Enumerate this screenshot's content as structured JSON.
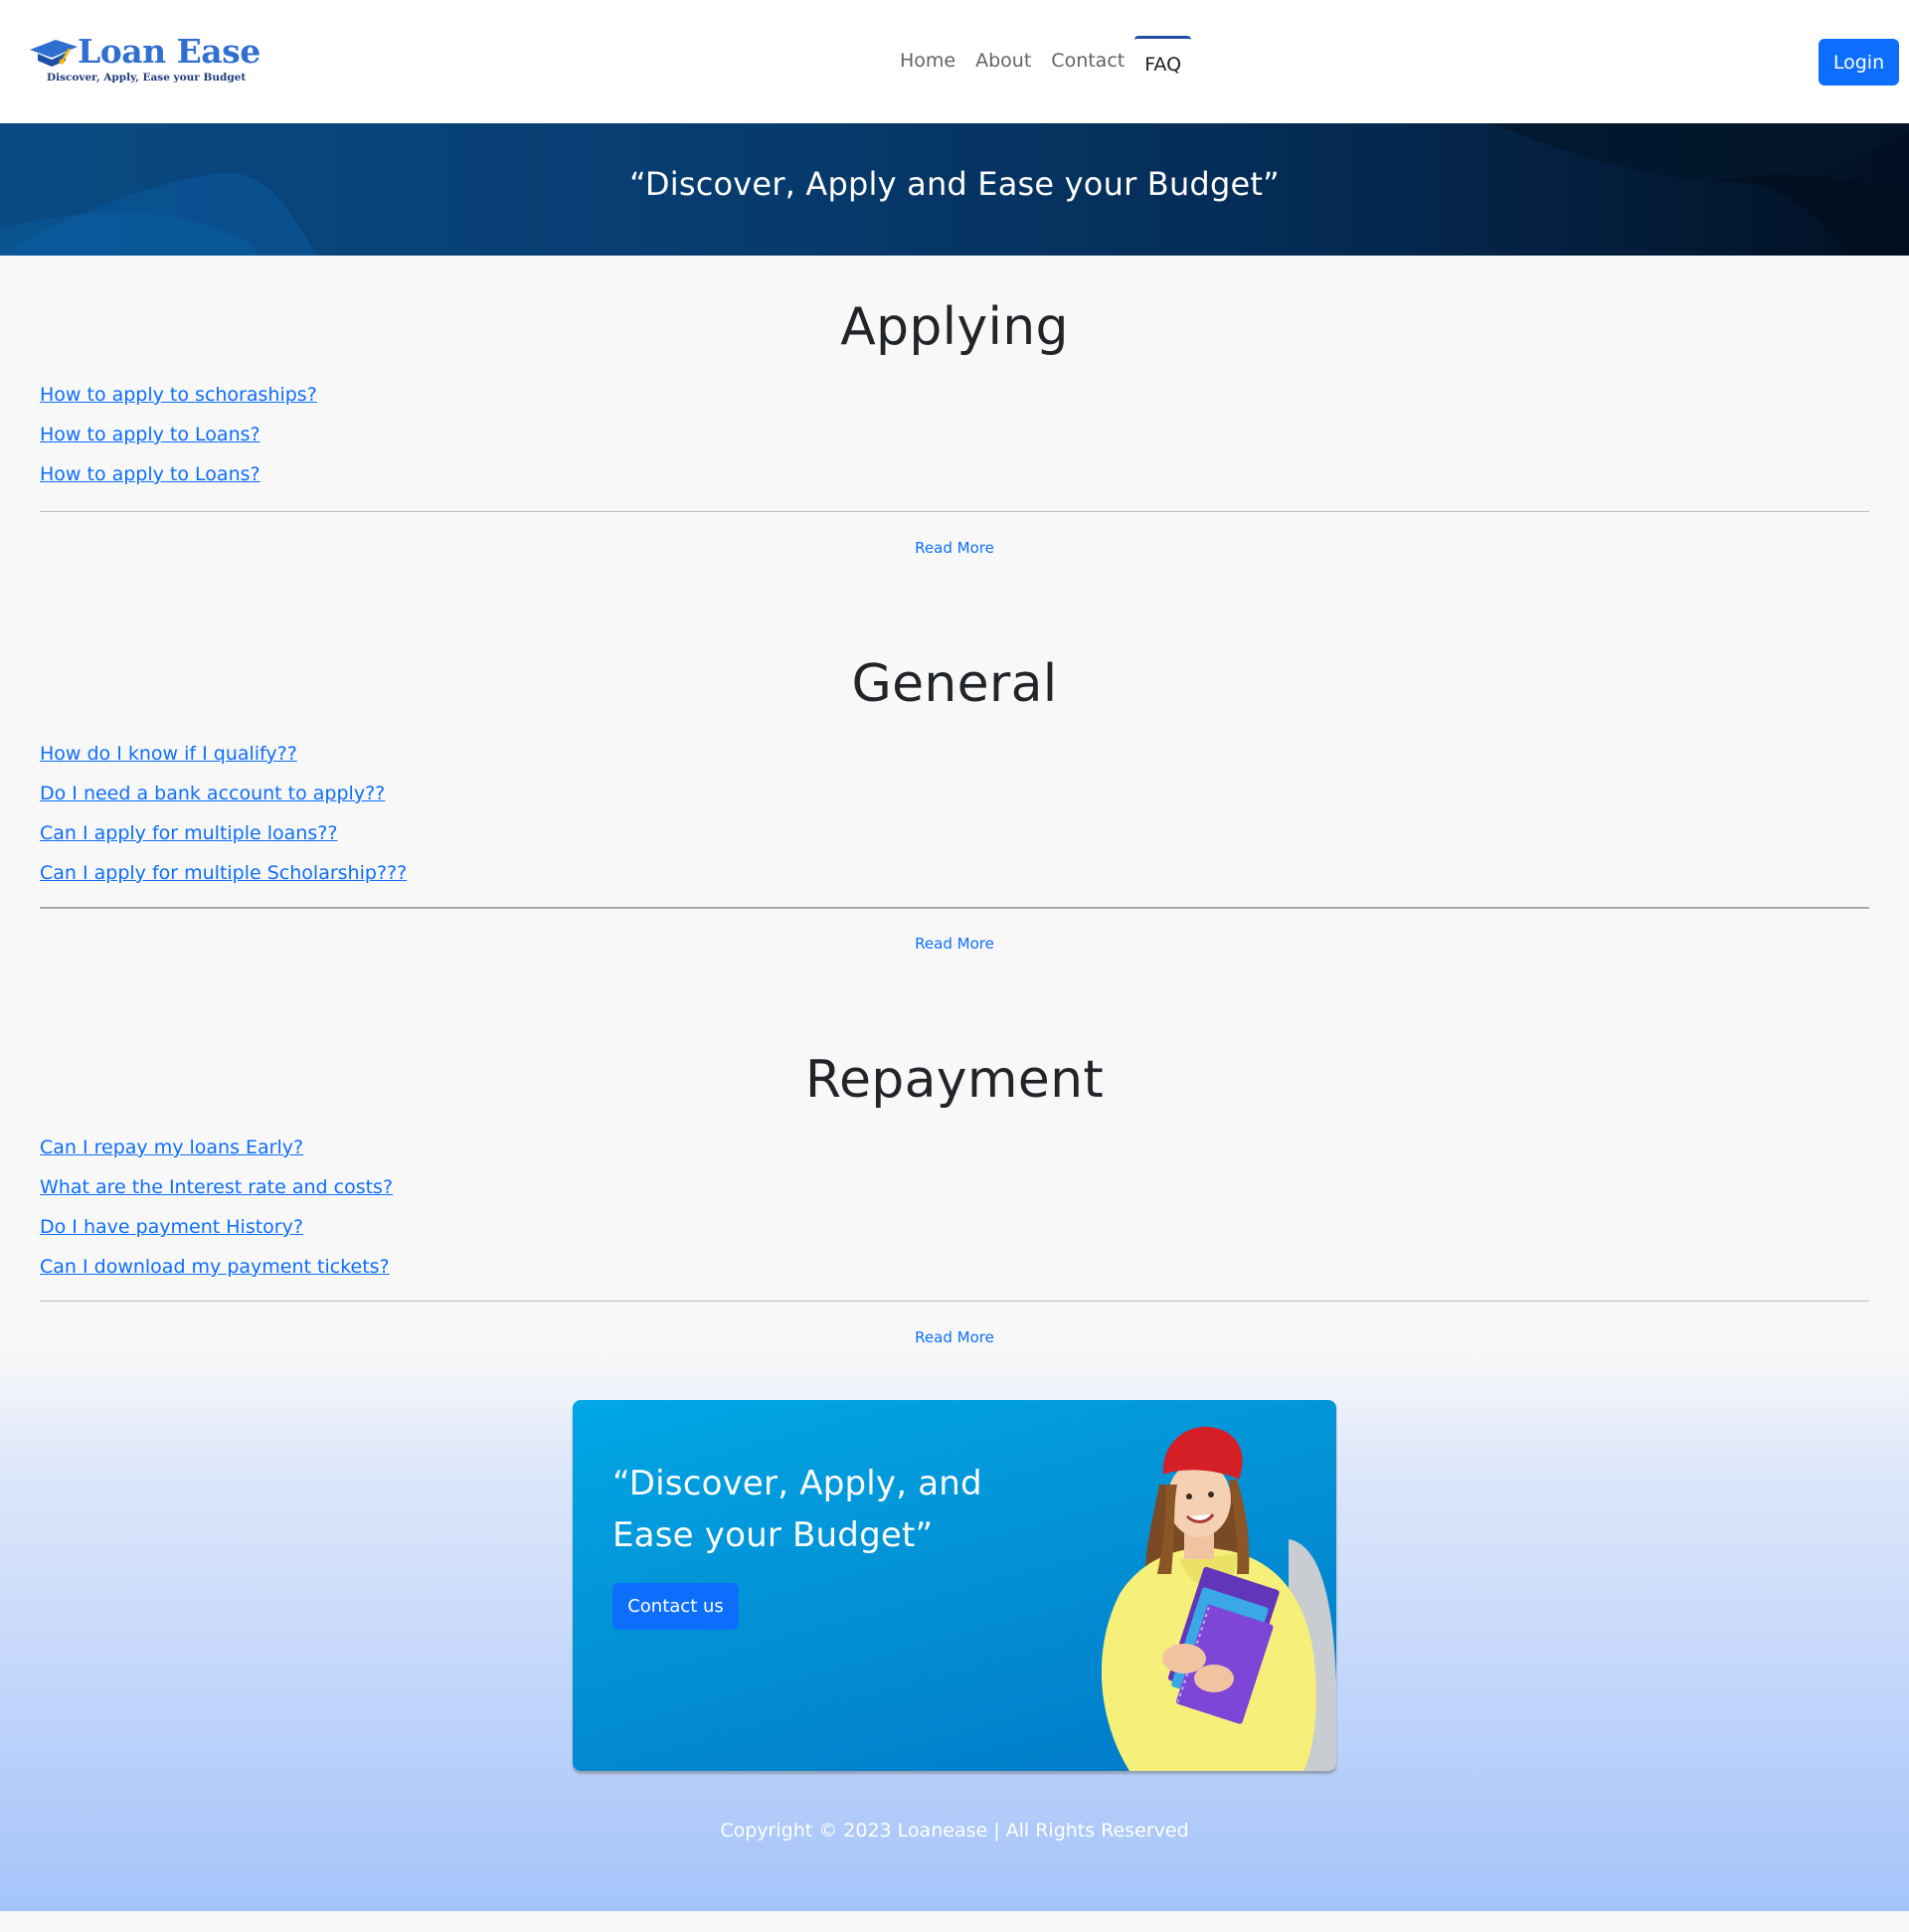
{
  "header": {
    "brand_name": "Loan Ease",
    "brand_tagline": "Discover, Apply, Ease your Budget",
    "nav": [
      {
        "label": "Home"
      },
      {
        "label": "About"
      },
      {
        "label": "Contact"
      },
      {
        "label": "FAQ",
        "active": true
      }
    ],
    "login_label": "Login"
  },
  "hero": {
    "quote": "“Discover, Apply and Ease your Budget”"
  },
  "faq": {
    "sections": [
      {
        "title": "Applying",
        "questions": [
          "How to apply to schoraships?",
          "How to apply to Loans?",
          "How to apply to Loans?"
        ],
        "read_more": "Read More"
      },
      {
        "title": "General",
        "questions": [
          "How do I know if I qualify??",
          "Do I need a bank account to apply??",
          "Can I apply for multiple loans??",
          "Can I apply for multiple Scholarship???"
        ],
        "read_more": "Read More"
      },
      {
        "title": "Repayment",
        "questions": [
          "Can I repay my loans Early?",
          "What are the Interest rate and costs?",
          "Do I have payment History?",
          "Can I download my payment tickets?"
        ],
        "read_more": "Read More"
      }
    ]
  },
  "cta": {
    "quote_line1": "“Discover, Apply, and",
    "quote_line2": "Ease your Budget”",
    "button_label": "Contact us"
  },
  "footer": {
    "copyright": "Copyright © 2023 Loanease | All Rights Reserved"
  },
  "colors": {
    "primary": "#0d6efd",
    "brand": "#2f6fd0",
    "hero_dark": "#042a52",
    "cta_blue": "#0392d6"
  }
}
